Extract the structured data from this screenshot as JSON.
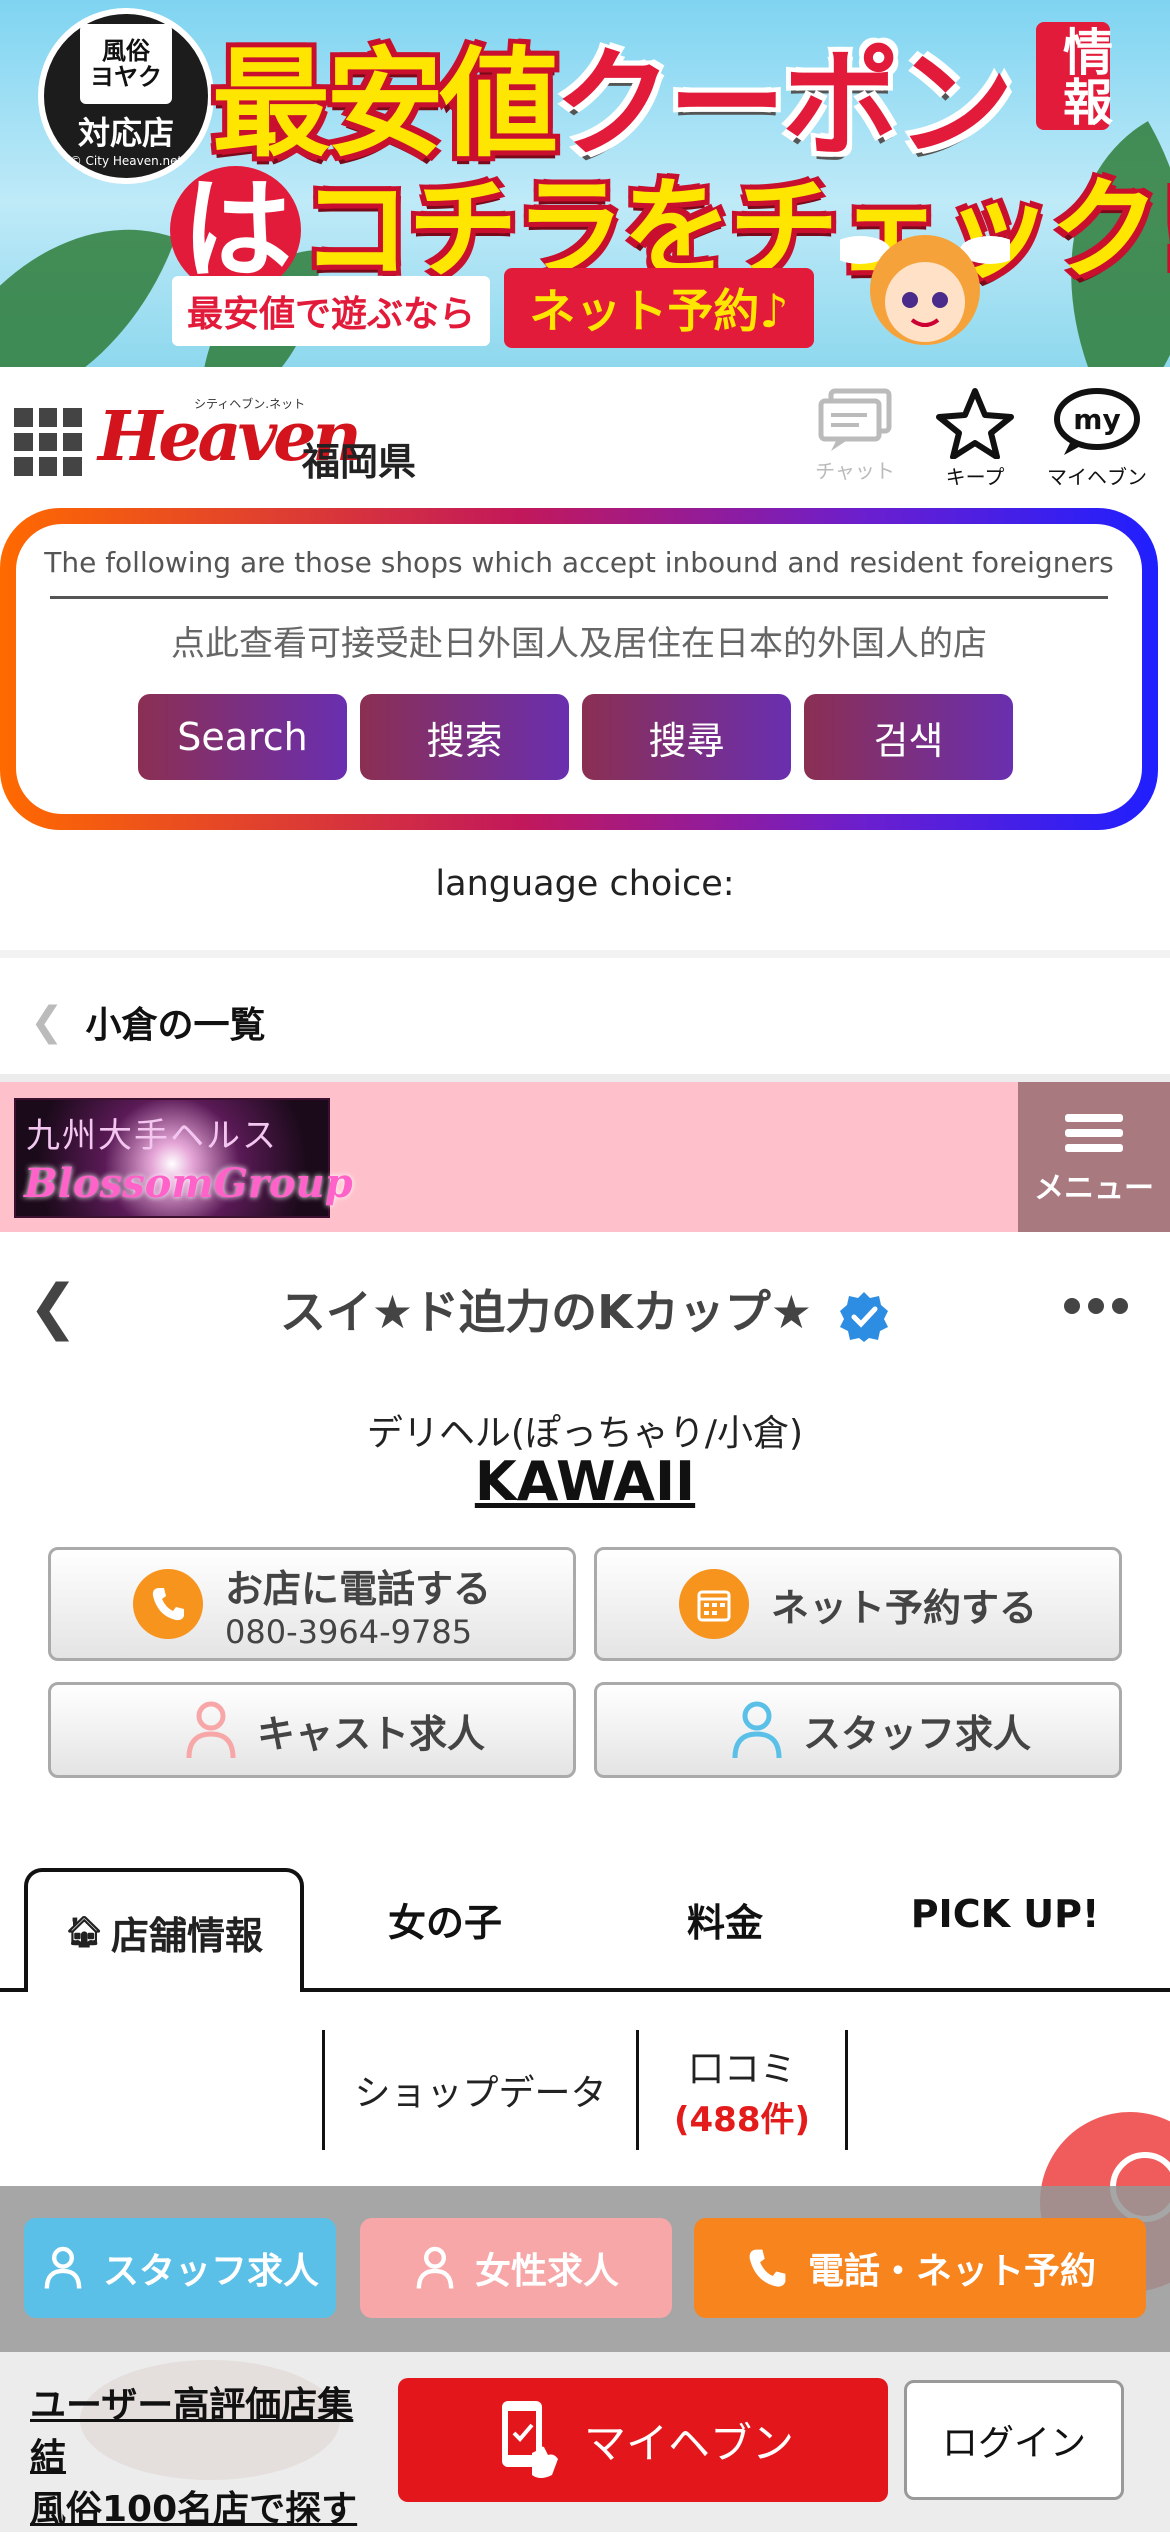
{
  "banner": {
    "badge_box": "風俗\nヨヤク",
    "badge_main": "対応店",
    "badge_small": "© City Heaven.net",
    "title_part1": "最安値",
    "title_part2": "クーポン",
    "title_side": "情報",
    "title2_ha": "は",
    "title2_rest": "コチラをチェック!",
    "pill_left": "最安値で遊ぶなら",
    "pill_right": "ネット予約♪"
  },
  "header": {
    "logo": "Heaven",
    "logo_small": "シティヘブン.ネット",
    "prefecture": "福岡県",
    "chat_label": "チャット",
    "keep_label": "キープ",
    "my_label": "マイヘブン",
    "my_icon_text": "my"
  },
  "inbound": {
    "english": "The following are those shops which accept inbound and resident foreigners",
    "chinese": "点此查看可接受赴日外国人及居住在日本的外国人的店",
    "buttons": [
      "Search",
      "搜索",
      "搜尋",
      "검색"
    ]
  },
  "language_choice": "language choice:",
  "back_list": "小倉の一覧",
  "shop_logo": {
    "line1": "九州大手ヘルス",
    "line2": "BlossomGroup"
  },
  "menu_label": "メニュー",
  "title": "スイ★ド迫力のKカップ★",
  "genre": "デリヘル(ぽっちゃり/小倉)",
  "shop_name": "KAWAII",
  "actions": {
    "call_label": "お店に電話する",
    "phone": "080-3964-9785",
    "reserve_label": "ネット予約する",
    "cast_recruit": "キャスト求人",
    "staff_recruit": "スタッフ求人"
  },
  "tabs": [
    "店舗情報",
    "女の子",
    "料金",
    "PICK UP!"
  ],
  "subtabs": {
    "shop_data": "ショップデータ",
    "reviews": "口コミ",
    "review_count": "(488件)"
  },
  "sticky": {
    "staff": "スタッフ求人",
    "female": "女性求人",
    "call_reserve": "電話・ネット予約"
  },
  "bottom": {
    "promo": "ユーザー高評価店集結\n風俗100名店で探す",
    "myheaven": "マイヘブン",
    "login": "ログイン"
  },
  "colors": {
    "brand_red": "#d3141d",
    "accent_orange": "#f7941d",
    "shop_pink": "#fec0ca",
    "staff_blue": "#5bc0e8",
    "female_pink": "#f7a7a7",
    "review_red": "#e31b1b"
  }
}
